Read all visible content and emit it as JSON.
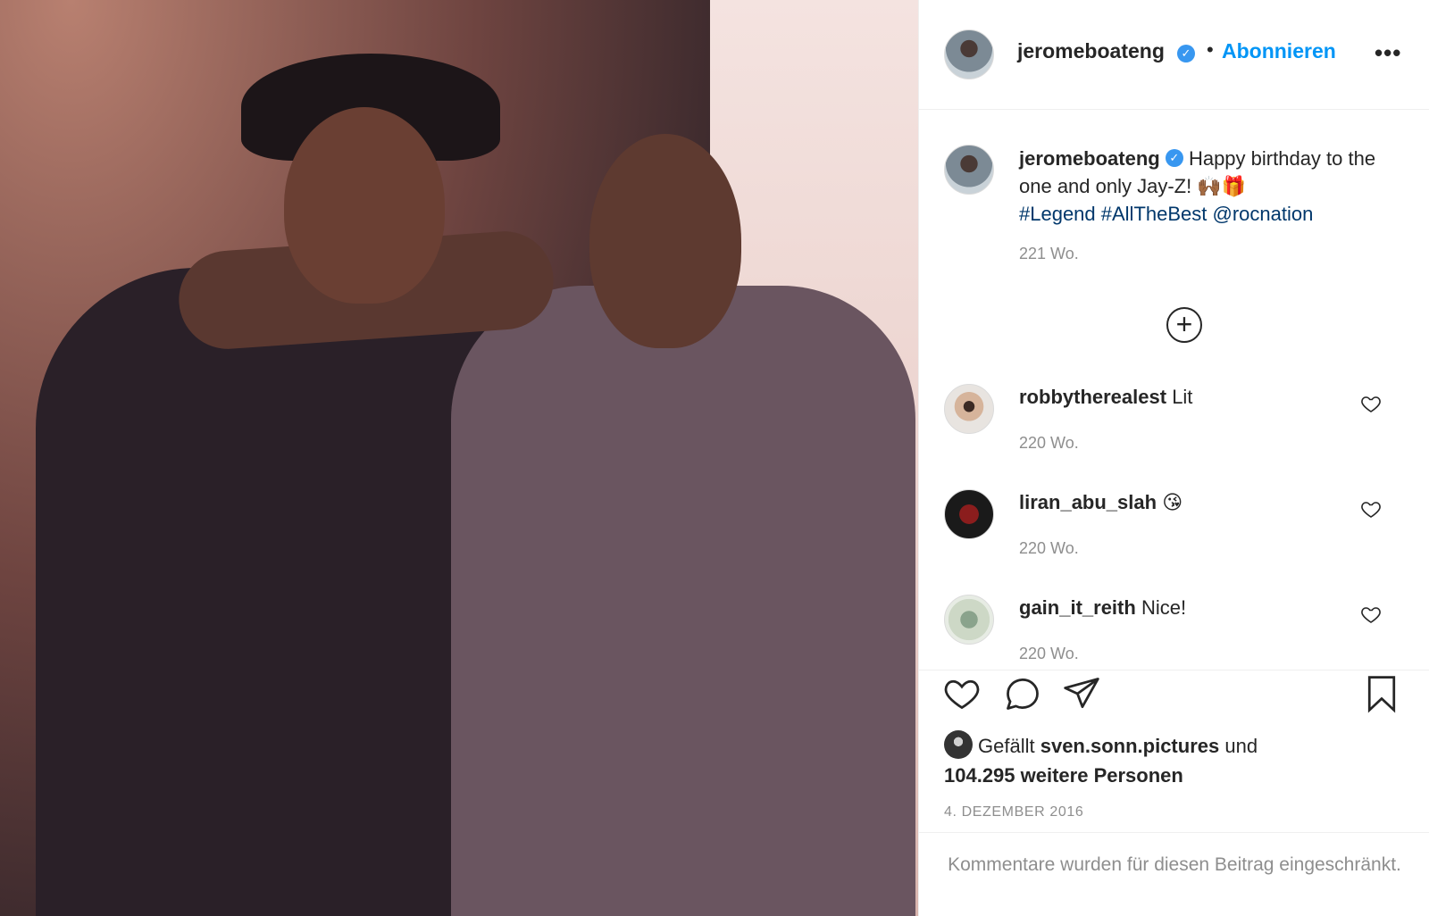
{
  "post": {
    "image_alt": "Photo of two men standing together",
    "author": {
      "username": "jeromeboateng",
      "verified_icon": "verified-badge-icon",
      "follow_label": "Abonnieren",
      "separator": "•",
      "more_label": "•••"
    },
    "caption": {
      "username": "jeromeboateng",
      "text": "Happy birthday to the one and only Jay-Z! 🙌🏾🎁",
      "hashtags": "#Legend #AllTheBest @rocnation",
      "time": "221 Wo."
    },
    "load_more_label": "+",
    "comments": [
      {
        "username": "robbytherealest",
        "text": "Lit",
        "time": "220 Wo."
      },
      {
        "username": "liran_abu_slah",
        "text": "😘",
        "time": "220 Wo."
      },
      {
        "username": "gain_it_reith",
        "text": "Nice!",
        "time": "220 Wo."
      }
    ],
    "likes": {
      "prefix": "Gefällt",
      "user": "sven.sonn.pictures",
      "conj": "und",
      "count_text": "104.295 weitere Personen"
    },
    "date": "4. DEZEMBER 2016",
    "restricted_text": "Kommentare wurden für diesen Beitrag eingeschränkt."
  },
  "colors": {
    "accent": "#0095f6",
    "verified": "#3897f0",
    "muted": "#8e8e8e",
    "hashtag": "#00376b"
  }
}
